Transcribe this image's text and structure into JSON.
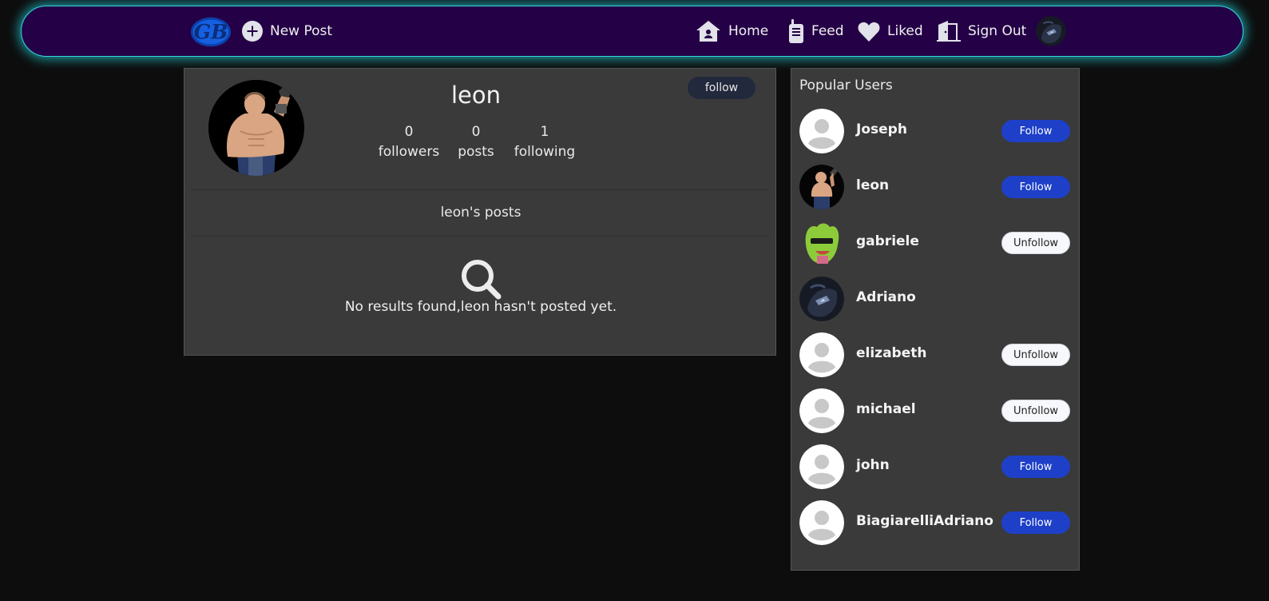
{
  "colors": {
    "navbar_bg": "#240046",
    "navbar_glow": "#35d6de",
    "page_bg": "#0d0d0d",
    "card_bg": "#3a3a3a",
    "follow_button": "#1e40c8",
    "unfollow_button": "#f6f8fc"
  },
  "nav": {
    "logo_text": "GB",
    "new_post": "New Post",
    "home": "Home",
    "feed": "Feed",
    "liked": "Liked",
    "sign_out": "Sign Out",
    "icons": [
      "plus-circle-icon",
      "home-icon",
      "walkie-talkie-icon",
      "heart-icon",
      "door-exit-icon"
    ]
  },
  "profile": {
    "name": "leon",
    "follow_label": "follow",
    "followers_count": "0",
    "followers_label": "followers",
    "posts_count": "0",
    "posts_label": "posts",
    "following_count": "1",
    "following_label": "following",
    "posts_title": "leon's posts",
    "empty_message": "No results found,leon hasn't posted yet."
  },
  "popular": {
    "title": "Popular Users",
    "users": [
      {
        "name": "Joseph",
        "action": "Follow",
        "avatar": "default"
      },
      {
        "name": "leon",
        "action": "Follow",
        "avatar": "leon"
      },
      {
        "name": "gabriele",
        "action": "Unfollow",
        "avatar": "frog"
      },
      {
        "name": "Adriano",
        "action": "",
        "avatar": "dark"
      },
      {
        "name": "elizabeth",
        "action": "Unfollow",
        "avatar": "default"
      },
      {
        "name": "michael",
        "action": "Unfollow",
        "avatar": "default"
      },
      {
        "name": "john",
        "action": "Follow",
        "avatar": "default"
      },
      {
        "name": "BiagiarelliAdriano",
        "action": "Follow",
        "avatar": "default"
      }
    ]
  }
}
